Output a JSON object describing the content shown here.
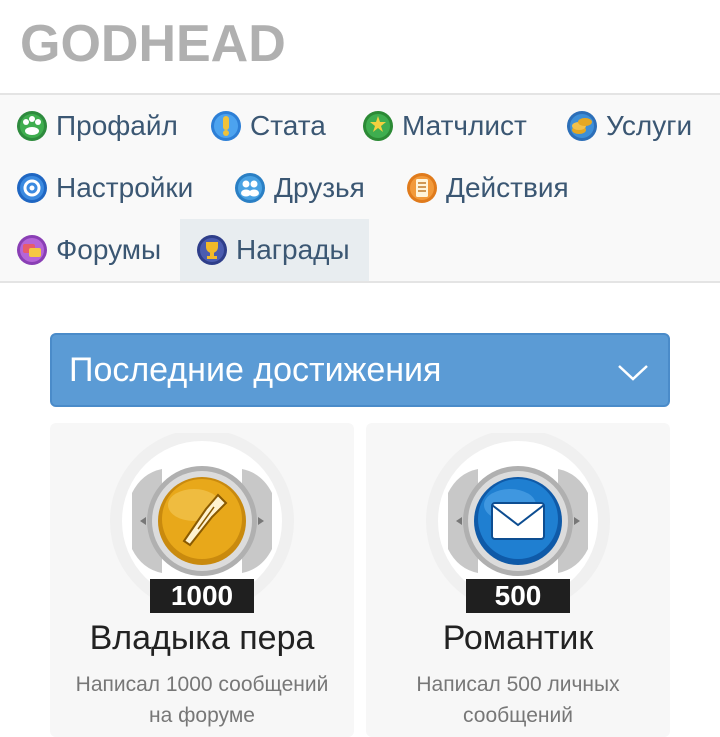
{
  "header": {
    "logo": "GODHEAD"
  },
  "nav": {
    "items": [
      {
        "label": "Профайл",
        "icon": "profile-icon"
      },
      {
        "label": "Стата",
        "icon": "stats-icon"
      },
      {
        "label": "Матчлист",
        "icon": "matchlist-icon"
      },
      {
        "label": "Услуги",
        "icon": "services-icon"
      },
      {
        "label": "Настройки",
        "icon": "settings-icon"
      },
      {
        "label": "Друзья",
        "icon": "friends-icon"
      },
      {
        "label": "Действия",
        "icon": "actions-icon"
      },
      {
        "label": "Форумы",
        "icon": "forums-icon"
      },
      {
        "label": "Награды",
        "icon": "awards-icon",
        "active": true
      }
    ]
  },
  "section": {
    "title": "Последние достижения",
    "icon": "chevron-down-icon"
  },
  "achievements": [
    {
      "badge": "1000",
      "title": "Владыка пера",
      "description": "Написал 1000 сообщений на форуме",
      "icon": "pen-medal-icon",
      "color": "#e0a21a"
    },
    {
      "badge": "500",
      "title": "Романтик",
      "description": "Написал 500 личных сообщений",
      "icon": "envelope-medal-icon",
      "color": "#1f7fd1"
    }
  ]
}
